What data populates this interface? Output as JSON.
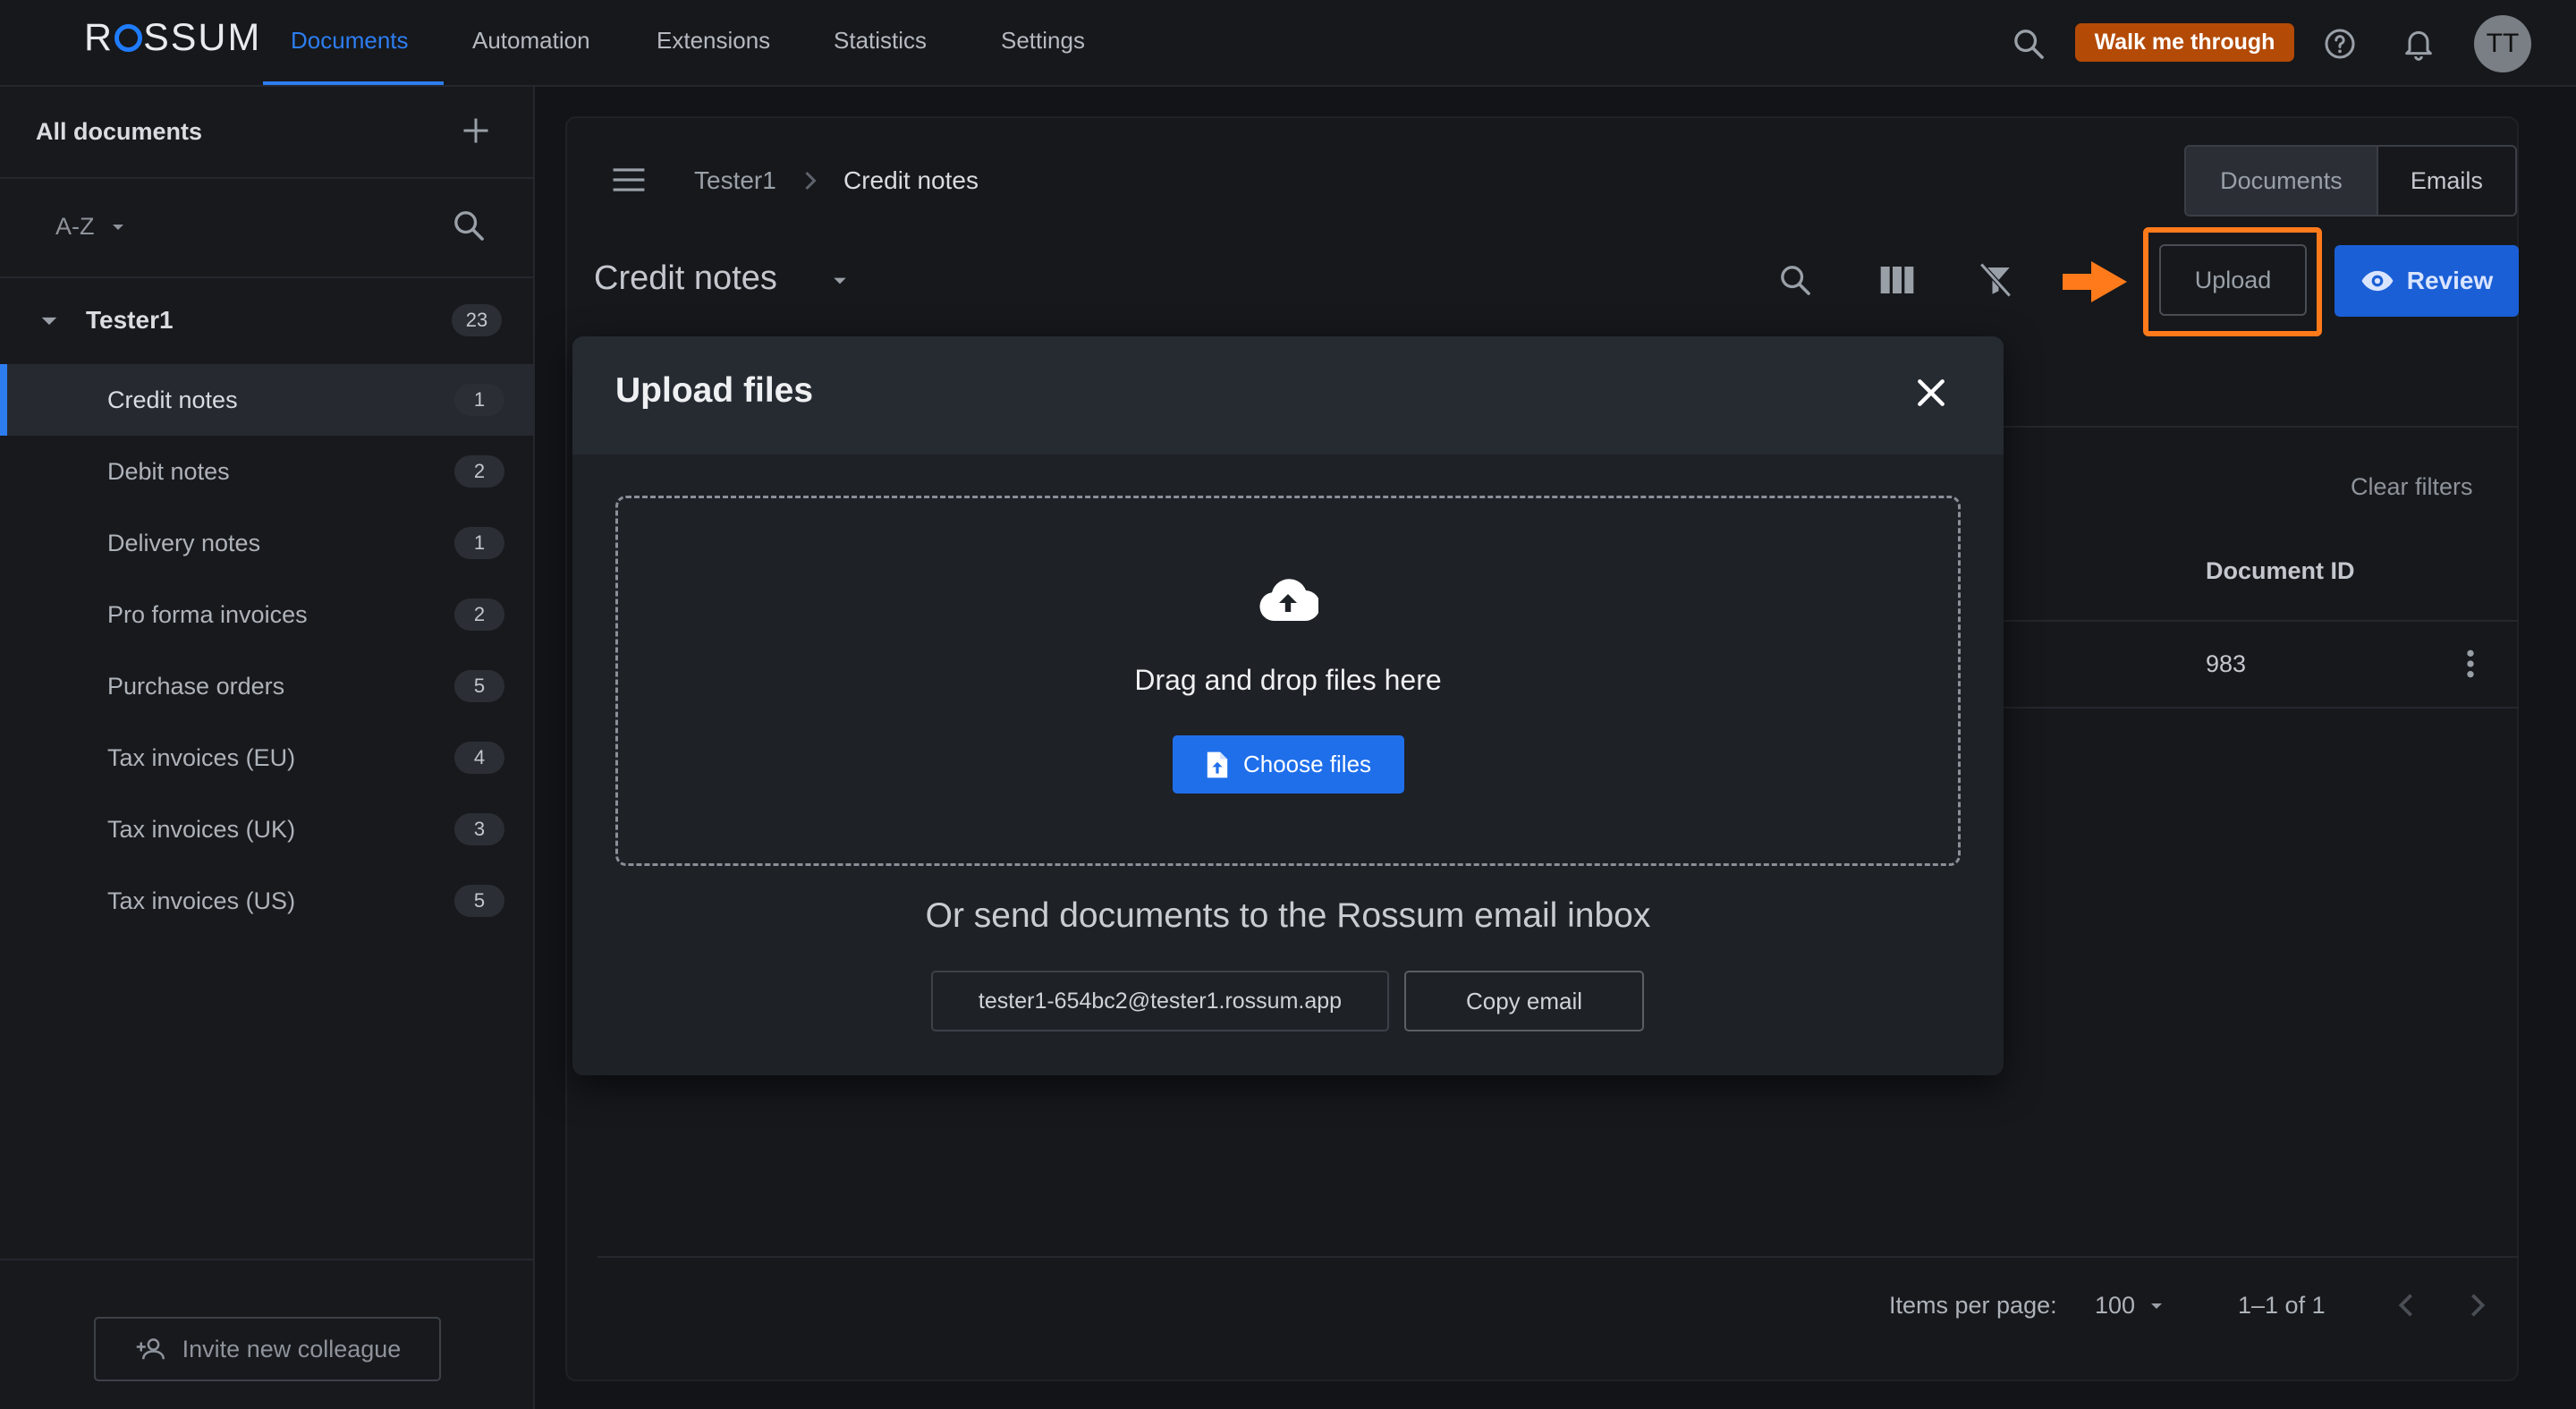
{
  "brand": {
    "logo": "ROSSUM",
    "accent": "#2d7df0"
  },
  "topnav": {
    "items": [
      {
        "label": "Documents",
        "active": true
      },
      {
        "label": "Automation"
      },
      {
        "label": "Extensions"
      },
      {
        "label": "Statistics"
      },
      {
        "label": "Settings"
      }
    ],
    "walk_me_through": "Walk me through",
    "avatar_initials": "TT",
    "icons": [
      "search-icon",
      "help-icon",
      "bell-icon"
    ]
  },
  "sidebar": {
    "title": "All documents",
    "sort_label": "A-Z",
    "group": {
      "name": "Tester1",
      "count": "23"
    },
    "queues": [
      {
        "label": "Credit notes",
        "count": "1",
        "active": true
      },
      {
        "label": "Debit notes",
        "count": "2"
      },
      {
        "label": "Delivery notes",
        "count": "1"
      },
      {
        "label": "Pro forma invoices",
        "count": "2"
      },
      {
        "label": "Purchase orders",
        "count": "5"
      },
      {
        "label": "Tax invoices (EU)",
        "count": "4"
      },
      {
        "label": "Tax invoices (UK)",
        "count": "3"
      },
      {
        "label": "Tax invoices (US)",
        "count": "5"
      }
    ],
    "invite_label": "Invite new colleague"
  },
  "main": {
    "breadcrumb": [
      "Tester1",
      "Credit notes"
    ],
    "view_toggle": [
      {
        "label": "Documents",
        "active": true
      },
      {
        "label": "Emails"
      }
    ],
    "queue_title": "Credit notes",
    "upload_label": "Upload",
    "review_label": "Review",
    "clear_filters": "Clear filters",
    "table": {
      "visible_header": "Document ID",
      "rows": [
        {
          "document_id": "983"
        }
      ]
    },
    "pagination": {
      "items_per_page_label": "Items per page:",
      "items_per_page_value": "100",
      "range": "1–1 of 1"
    }
  },
  "modal": {
    "title": "Upload files",
    "drop_text": "Drag and drop files here",
    "choose_label": "Choose files",
    "email_heading": "Or send documents to the Rossum email inbox",
    "email_address": "tester1-654bc2@tester1.rossum.app",
    "copy_label": "Copy email"
  },
  "highlight_color": "#ff7a1a"
}
